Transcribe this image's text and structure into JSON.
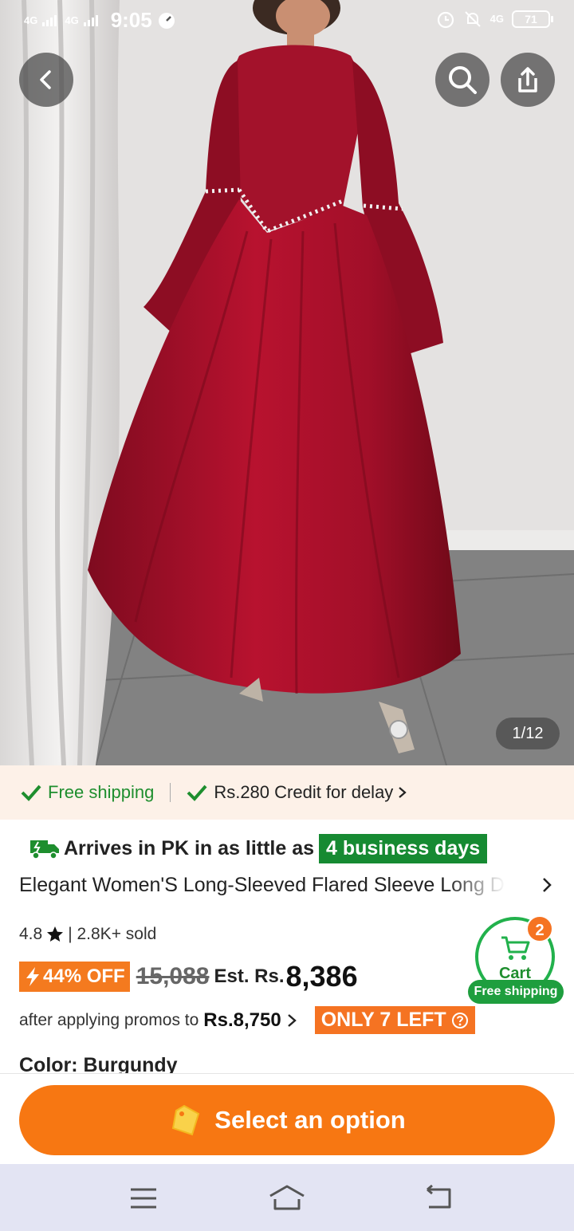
{
  "status_bar": {
    "signal1": "4G",
    "signal2": "4G",
    "time": "9:05",
    "net": "4G",
    "battery": "71"
  },
  "hero": {
    "image_counter": "1/12"
  },
  "shipping_strip": {
    "free_shipping": "Free shipping",
    "credit": "Rs.280 Credit for delay"
  },
  "product": {
    "arrive_text": "Arrives in PK in as little as",
    "arrive_days": "4 business days",
    "title": "Elegant Women'S Long-Sleeved Flared Sleeve Long Dress",
    "rating": "4.8",
    "sold": "| 2.8K+ sold",
    "discount": "44% OFF",
    "old_price": "15,088",
    "est_label": "Est. Rs.",
    "est_price": "8,386",
    "promo_text": "after applying promos to",
    "promo_price": "Rs.8,750",
    "stock_badge": "ONLY 7 LEFT",
    "color_label": "Color: Burgundy"
  },
  "cart": {
    "label": "Cart",
    "count": "2",
    "free_shipping": "Free shipping"
  },
  "cta": {
    "label": "Select an option"
  },
  "colors": {
    "accent_orange": "#f77712",
    "shipping_green": "#1e8e2e",
    "dress_red": "#a0102a"
  }
}
